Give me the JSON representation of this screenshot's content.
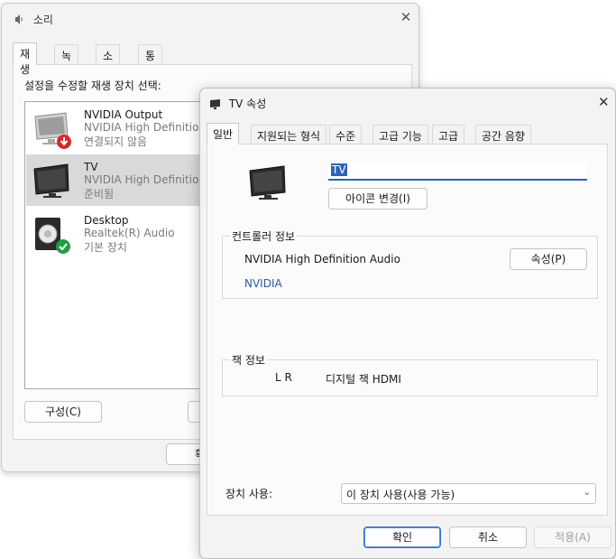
{
  "back_window": {
    "title": "소리",
    "close_glyph": "✕",
    "tabs": [
      {
        "label": "재생",
        "active": true
      },
      {
        "label": "녹음",
        "active": false
      },
      {
        "label": "소리",
        "active": false
      },
      {
        "label": "통신",
        "active": false
      }
    ],
    "prompt": "설정을 수정할 재생 장치 선택:",
    "devices": [
      {
        "name": "NVIDIA Output",
        "driver": "NVIDIA High Definition",
        "status": "연결되지 않음",
        "selected": false,
        "badge": "disconnected"
      },
      {
        "name": "TV",
        "driver": "NVIDIA High Definition",
        "status": "준비됨",
        "selected": true,
        "badge": "none"
      },
      {
        "name": "Desktop",
        "driver": "Realtek(R) Audio",
        "status": "기본 장치",
        "selected": false,
        "badge": "default"
      }
    ],
    "configure_button": "구성(C)",
    "partial_button": "기",
    "partial_ok_button": "확"
  },
  "front_window": {
    "title": "TV 속성",
    "close_glyph": "✕",
    "tabs": [
      {
        "label": "일반",
        "active": true
      },
      {
        "label": "지원되는 형식",
        "active": false
      },
      {
        "label": "수준",
        "active": false
      },
      {
        "label": "고급 기능",
        "active": false
      },
      {
        "label": "고급",
        "active": false
      },
      {
        "label": "공간 음향",
        "active": false
      }
    ],
    "device_name_value": "TV",
    "change_icon_button": "아이콘 변경(I)",
    "controller_group": {
      "title": "컨트롤러 정보",
      "controller_name": "NVIDIA High Definition Audio",
      "vendor": "NVIDIA",
      "properties_button": "속성(P)"
    },
    "jack_group": {
      "title": "잭 정보",
      "jack_channels": "L R",
      "jack_type": "디지털 잭 HDMI"
    },
    "device_usage_label": "장치 사용:",
    "device_usage_value": "이 장치 사용(사용 가능)",
    "buttons": {
      "ok": "확인",
      "cancel": "취소",
      "apply": "적용(A)"
    }
  },
  "colors": {
    "accent": "#2b64b8",
    "window_bg": "#f3f3f3",
    "panel_bg": "#fbfbfb",
    "selection": "#d9d9d9",
    "link": "#2c5a9e"
  }
}
